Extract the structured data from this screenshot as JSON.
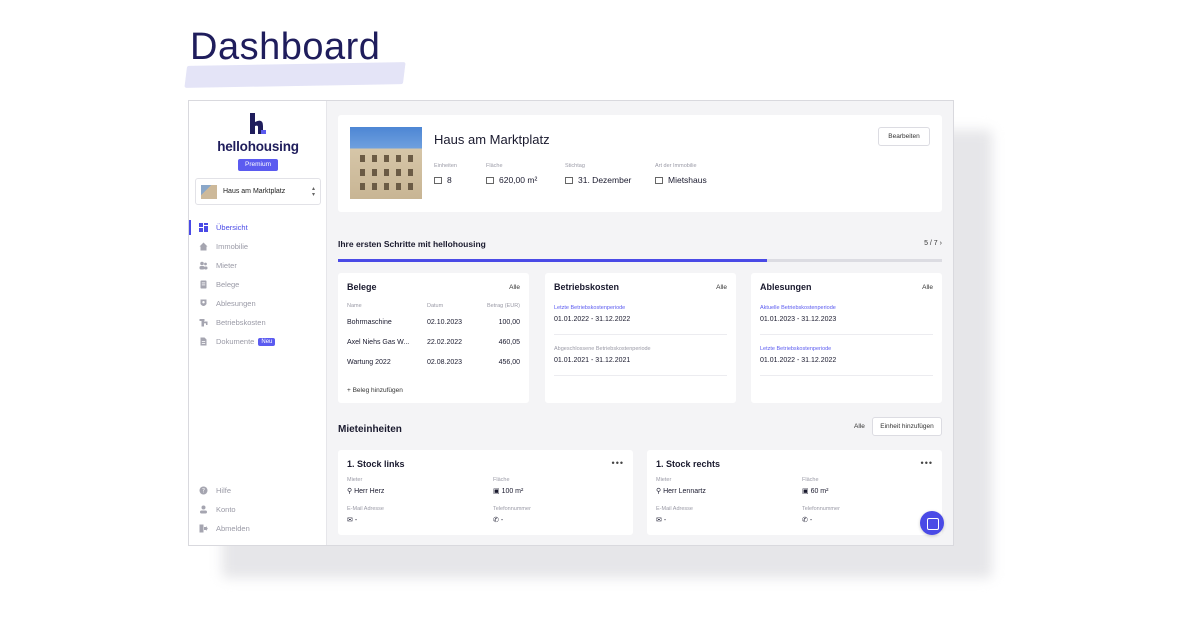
{
  "hero": {
    "title": "Dashboard"
  },
  "brand": {
    "name": "hellohousing",
    "plan": "Premium"
  },
  "property_selector": {
    "value": "Haus am Marktplatz"
  },
  "nav": {
    "items": [
      {
        "label": "Übersicht",
        "icon": "grid-icon",
        "active": true
      },
      {
        "label": "Immobilie",
        "icon": "home-icon"
      },
      {
        "label": "Mieter",
        "icon": "users-icon"
      },
      {
        "label": "Belege",
        "icon": "receipt-icon"
      },
      {
        "label": "Ablesungen",
        "icon": "meter-icon"
      },
      {
        "label": "Betriebskosten",
        "icon": "faucet-icon"
      },
      {
        "label": "Dokumente",
        "icon": "document-icon",
        "badge": "Neu"
      }
    ],
    "bottom": [
      {
        "label": "Hilfe",
        "icon": "help-icon"
      },
      {
        "label": "Konto",
        "icon": "user-icon"
      },
      {
        "label": "Abmelden",
        "icon": "logout-icon"
      }
    ]
  },
  "property": {
    "title": "Haus am Marktplatz",
    "edit_label": "Bearbeiten",
    "meta": [
      {
        "label": "Einheiten",
        "value": "8",
        "icon": "building-icon"
      },
      {
        "label": "Fläche",
        "value": "620,00 m²",
        "icon": "area-icon"
      },
      {
        "label": "Stichtag",
        "value": "31. Dezember",
        "icon": "calendar-icon"
      },
      {
        "label": "Art der Immobilie",
        "value": "Mietshaus",
        "icon": "house-type-icon"
      }
    ]
  },
  "steps": {
    "title": "Ihre ersten Schritte mit hellohousing",
    "count": "5 / 7",
    "progress": 0.71
  },
  "belege": {
    "title": "Belege",
    "all_label": "Alle",
    "headers": [
      "Name",
      "Datum",
      "Betrag (EUR)"
    ],
    "rows": [
      [
        "Bohrmaschine",
        "02.10.2023",
        "100,00"
      ],
      [
        "Axel Niehs Gas W...",
        "22.02.2022",
        "460,05"
      ],
      [
        "Wartung 2022",
        "02.08.2023",
        "456,00"
      ]
    ],
    "add_label": "+ Beleg hinzufügen"
  },
  "betriebskosten": {
    "title": "Betriebskosten",
    "all_label": "Alle",
    "current_label": "Letzte Betriebskostenperiode",
    "current_value": "01.01.2022 - 31.12.2022",
    "closed_label": "Abgeschlossene Betriebskostenperiode",
    "closed_value": "01.01.2021 - 31.12.2021"
  },
  "ablesungen": {
    "title": "Ablesungen",
    "all_label": "Alle",
    "current_label": "Aktuelle Betriebskostenperiode",
    "current_value": "01.01.2023 - 31.12.2023",
    "last_label": "Letzte Betriebskostenperiode",
    "last_value": "01.01.2022 - 31.12.2022"
  },
  "mieteinheiten": {
    "title": "Mieteinheiten",
    "all_label": "Alle",
    "add_label": "Einheit hinzufügen",
    "units": [
      {
        "title": "1. Stock links",
        "mieter_label": "Mieter",
        "mieter": "Herr Herz",
        "flaeche_label": "Fläche",
        "flaeche": "100 m²",
        "email_label": "E-Mail Adresse",
        "email": "-",
        "tel_label": "Telefonnummer",
        "tel": "-"
      },
      {
        "title": "1. Stock rechts",
        "mieter_label": "Mieter",
        "mieter": "Herr Lennartz",
        "flaeche_label": "Fläche",
        "flaeche": "60 m²",
        "email_label": "E-Mail Adresse",
        "email": "-",
        "tel_label": "Telefonnummer",
        "tel": "-"
      }
    ]
  },
  "colors": {
    "accent": "#4a4ae6",
    "brand_dark": "#1f1d5c"
  }
}
